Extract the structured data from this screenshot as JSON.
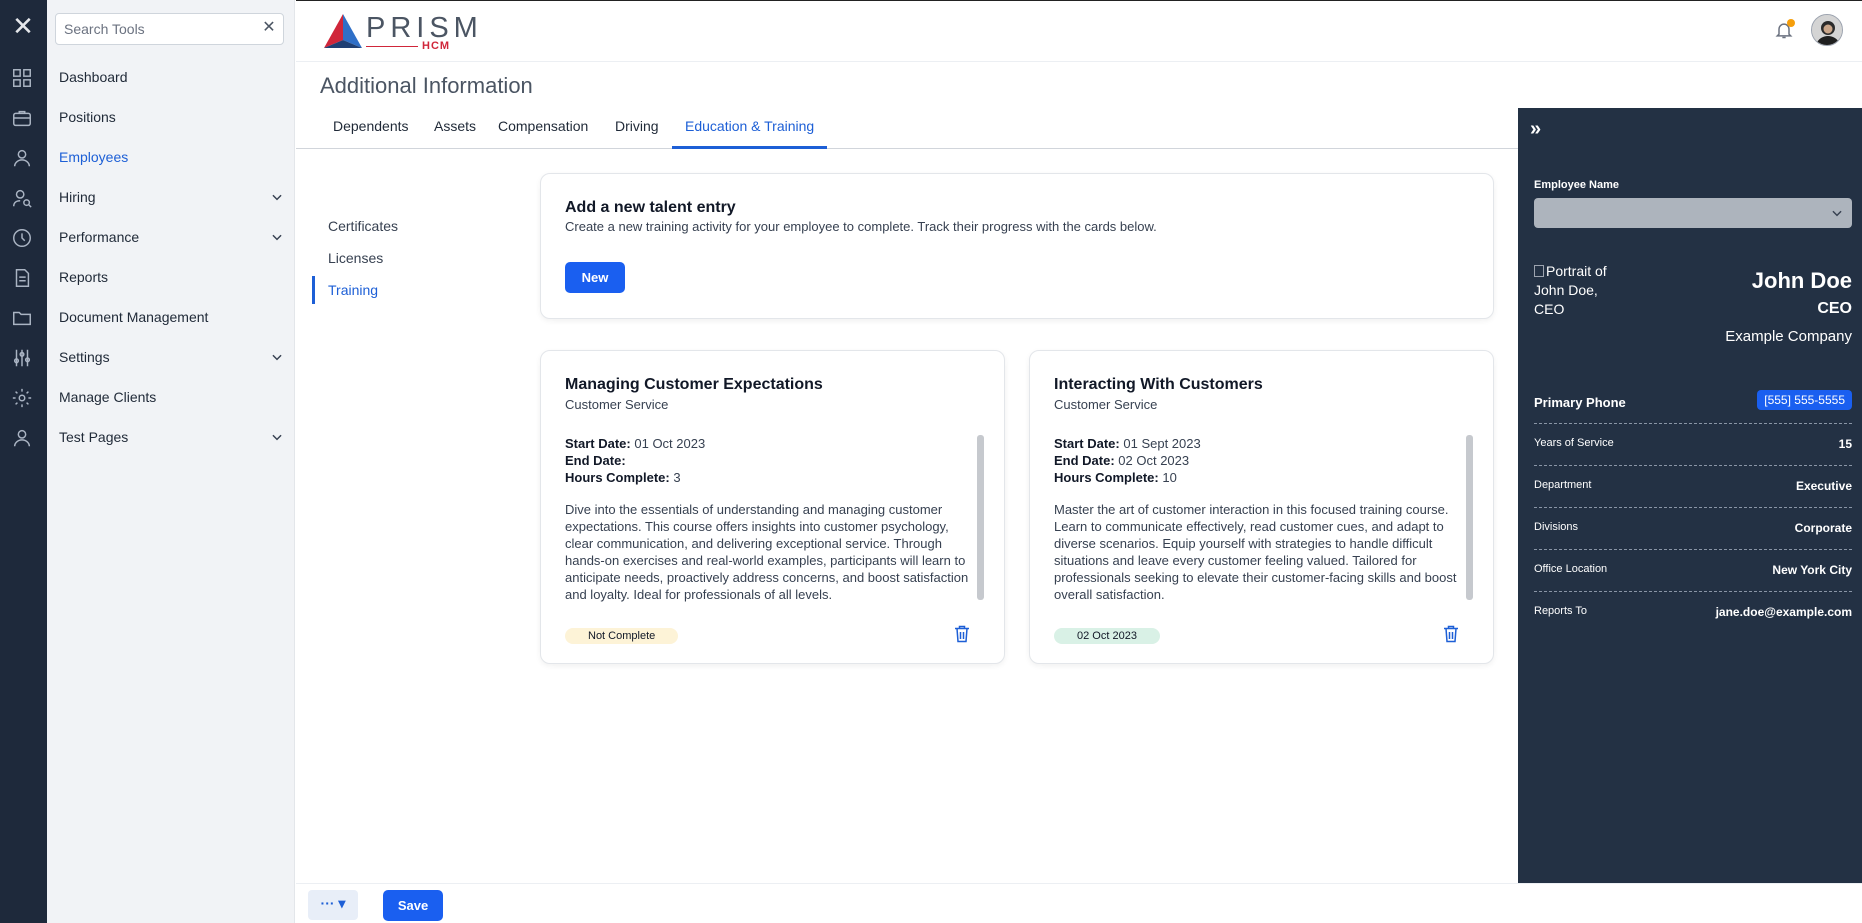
{
  "search": {
    "placeholder": "Search Tools",
    "clear_icon": "close-icon"
  },
  "rail": {
    "icons": [
      "dashboard-icon",
      "briefcase-icon",
      "user-icon",
      "hiring-icon",
      "performance-icon",
      "document-icon",
      "folder-icon",
      "sliders-icon",
      "gear-icon",
      "client-icon"
    ]
  },
  "sidebar": {
    "items": [
      {
        "label": "Dashboard",
        "expandable": false
      },
      {
        "label": "Positions",
        "expandable": false
      },
      {
        "label": "Employees",
        "expandable": false,
        "active": true
      },
      {
        "label": "Hiring",
        "expandable": true
      },
      {
        "label": "Performance",
        "expandable": true
      },
      {
        "label": "Reports",
        "expandable": false
      },
      {
        "label": "Document Management",
        "expandable": false
      },
      {
        "label": "Settings",
        "expandable": true
      },
      {
        "label": "Manage Clients",
        "expandable": false
      },
      {
        "label": "Test Pages",
        "expandable": true
      }
    ]
  },
  "header": {
    "logo_text": "PRISM",
    "logo_sub": "HCM"
  },
  "page": {
    "title": "Additional Information"
  },
  "tabs": [
    {
      "label": "Dependents"
    },
    {
      "label": "Assets"
    },
    {
      "label": "Compensation"
    },
    {
      "label": "Driving"
    },
    {
      "label": "Education & Training",
      "active": true
    }
  ],
  "subnav": [
    {
      "label": "Certificates"
    },
    {
      "label": "Licenses"
    },
    {
      "label": "Training",
      "active": true
    }
  ],
  "new_entry": {
    "title": "Add a new talent entry",
    "description": "Create a new training activity for your employee to complete. Track their progress with the cards below.",
    "button": "New"
  },
  "trainings": [
    {
      "title": "Managing Customer Expectations",
      "category": "Customer Service",
      "start_label": "Start Date:",
      "start": "01 Oct 2023",
      "end_label": "End Date:",
      "end": "",
      "hours_label": "Hours Complete:",
      "hours": "3",
      "description": "Dive into the essentials of understanding and managing customer expectations. This course offers insights into customer psychology, clear communication, and delivering exceptional service. Through hands-on exercises and real-world examples, participants will learn to anticipate needs, proactively address concerns, and boost satisfaction and loyalty. Ideal for professionals of all levels.",
      "badge": "Not Complete",
      "badge_color": "#fdf3d7"
    },
    {
      "title": "Interacting With Customers",
      "category": "Customer Service",
      "start_label": "Start Date:",
      "start": "01 Sept 2023",
      "end_label": "End Date:",
      "end": "02 Oct 2023",
      "hours_label": "Hours Complete:",
      "hours": "10",
      "description": "Master the art of customer interaction in this focused training course. Learn to communicate effectively, read customer cues, and adapt to diverse scenarios. Equip yourself with strategies to handle difficult situations and leave every customer feeling valued. Tailored for professionals seeking to elevate their customer-facing skills and boost overall satisfaction.",
      "badge": "02 Oct 2023",
      "badge_color": "#d9f1e6"
    }
  ],
  "panel": {
    "employee_label": "Employee Name",
    "portrait_alt": "Portrait of John Doe, CEO",
    "name": "John Doe",
    "role": "CEO",
    "company": "Example Company",
    "details": [
      {
        "label": "Primary Phone",
        "value": "[555] 555-5555"
      },
      {
        "label": "Years of Service",
        "value": "15"
      },
      {
        "label": "Department",
        "value": "Executive"
      },
      {
        "label": "Divisions",
        "value": "Corporate"
      },
      {
        "label": "Office Location",
        "value": "New York City"
      },
      {
        "label": "Reports To",
        "value": "jane.doe@example.com"
      }
    ]
  },
  "footer": {
    "more_label": "··· ▾",
    "save": "Save"
  },
  "colors": {
    "accent": "#1a5ff0",
    "panel_bg": "#233144",
    "rail_bg": "#1e293b",
    "brand_red": "#d0263a"
  }
}
